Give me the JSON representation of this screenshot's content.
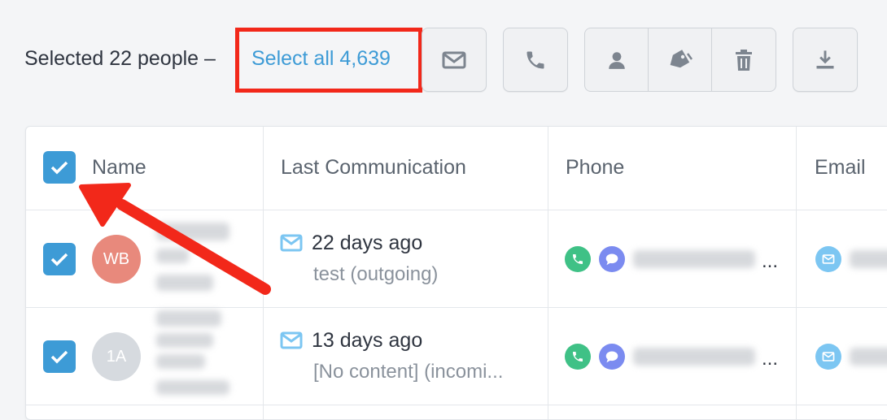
{
  "toolbar": {
    "selected_text": "Selected 22 people –",
    "select_all_label": "Select all 4,639",
    "icons": [
      "mail-icon",
      "phone-icon",
      "person-icon",
      "tag-icon",
      "trash-icon",
      "download-icon"
    ]
  },
  "table": {
    "headers": [
      "Name",
      "Last Communication",
      "Phone",
      "Email"
    ],
    "rows": [
      {
        "initials": "WB",
        "avatar_color": "#e8897c",
        "comm_title": "22 days ago",
        "comm_sub": "test (outgoing)",
        "phone_suffix": "...",
        "checked": true
      },
      {
        "initials": "1A",
        "avatar_color": "#d6dadf",
        "comm_title": "13 days ago",
        "comm_sub": "[No content] (incomi...",
        "phone_suffix": "...",
        "checked": true
      }
    ]
  },
  "colors": {
    "accent": "#3d9bd6",
    "highlight": "#f2281a",
    "phone_green": "#3fc186",
    "chat_purple": "#7b8bf0",
    "email_blue": "#7cc6f2"
  }
}
